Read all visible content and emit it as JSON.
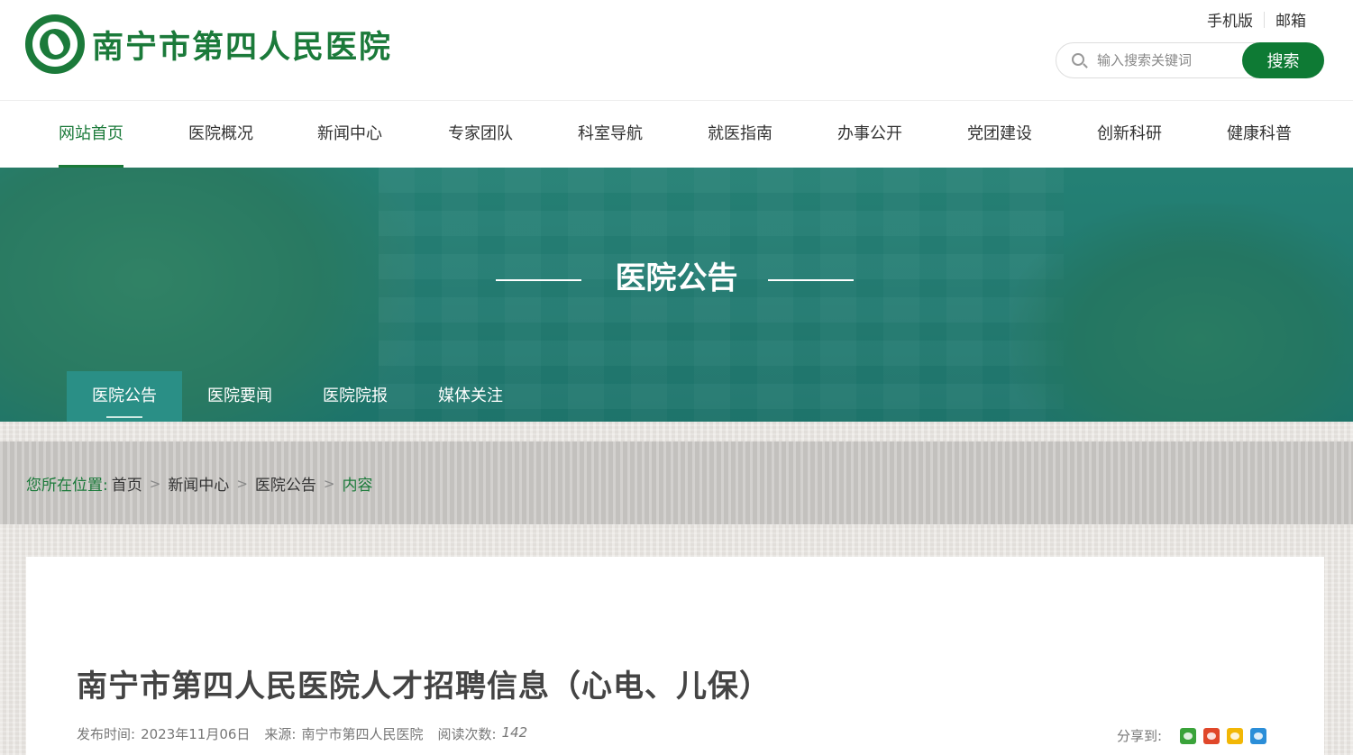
{
  "header": {
    "hospital_name": "南宁市第四人民医院",
    "links": [
      "手机版",
      "邮箱"
    ],
    "search": {
      "placeholder": "输入搜索关键词",
      "button_label": "搜索"
    }
  },
  "nav": {
    "items": [
      "网站首页",
      "医院概况",
      "新闻中心",
      "专家团队",
      "科室导航",
      "就医指南",
      "办事公开",
      "党团建设",
      "创新科研",
      "健康科普"
    ],
    "active": "网站首页"
  },
  "banner": {
    "title": "医院公告",
    "tabs": [
      "医院公告",
      "医院要闻",
      "医院院报",
      "媒体关注"
    ],
    "active_tab": "医院公告"
  },
  "breadcrumb": {
    "label": "您所在位置:",
    "items": [
      "首页",
      "新闻中心",
      "医院公告"
    ],
    "current": "内容",
    "separator": ">"
  },
  "article": {
    "title": "南宁市第四人民医院人才招聘信息（心电、儿保）",
    "publish_label": "发布时间:",
    "publish_date": "2023年11月06日",
    "source_label": "来源:",
    "source": "南宁市第四人民医院",
    "reads_label": "阅读次数:",
    "reads": "142",
    "share_label": "分享到:",
    "share_icons": [
      "wechat-icon",
      "weibo-icon",
      "qzone-icon",
      "tencent-weibo-icon"
    ]
  },
  "colors": {
    "brand_green": "#1b7a3a",
    "search_button": "#0e7a34",
    "banner_teal": "#2a8f86"
  }
}
